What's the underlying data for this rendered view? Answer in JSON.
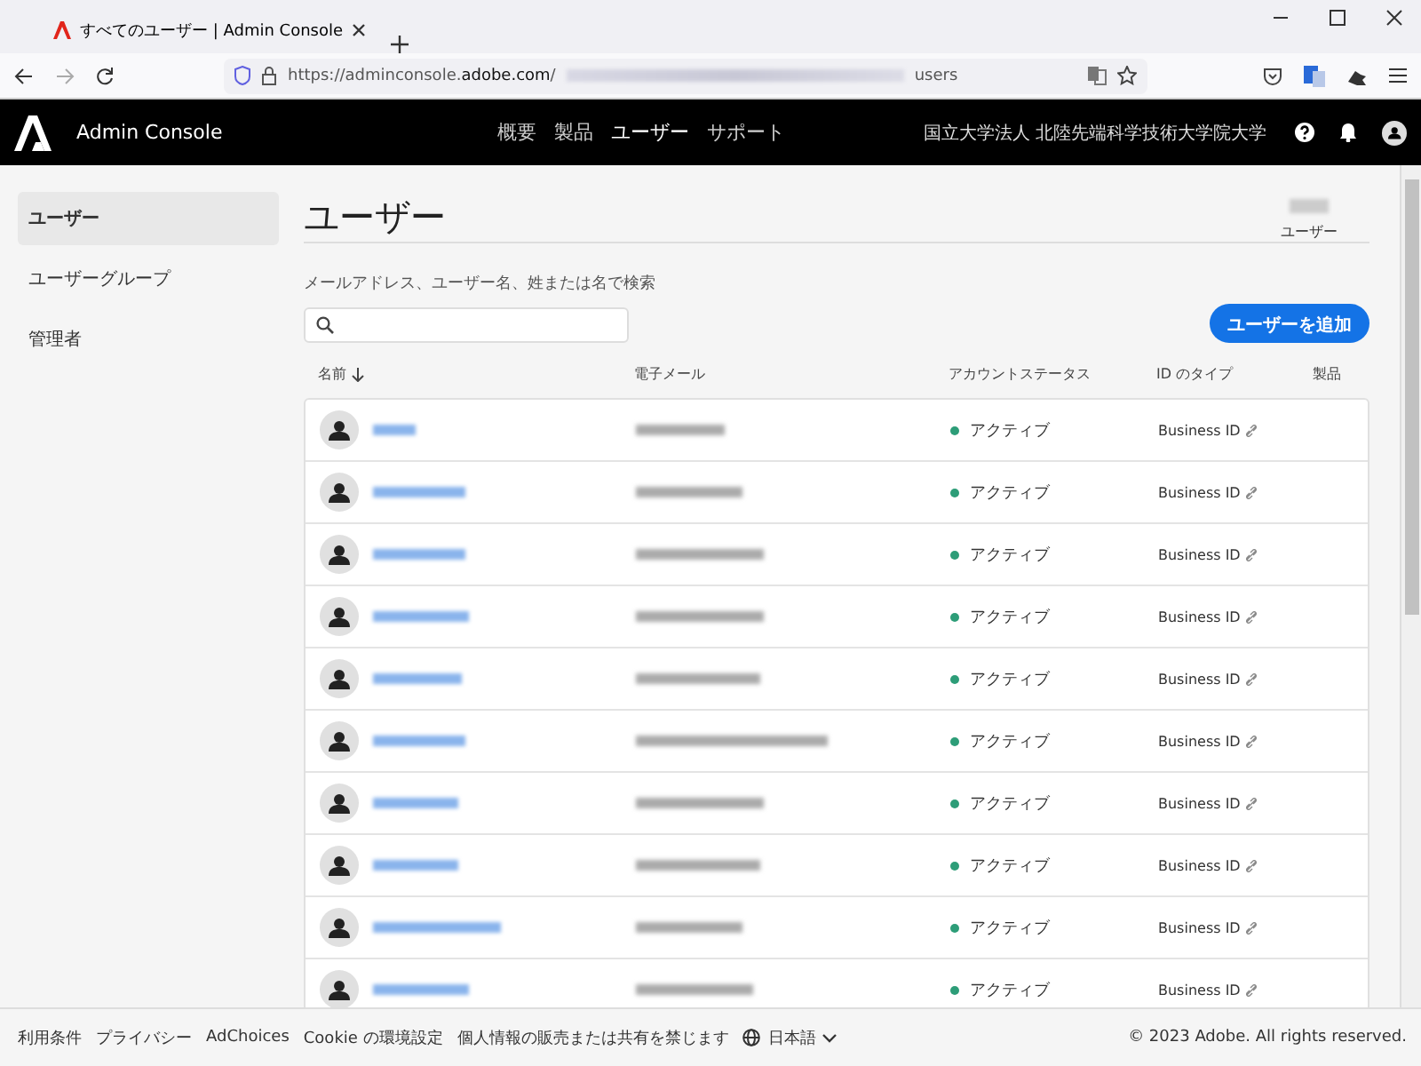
{
  "browser": {
    "tab_title": "すべてのユーザー | Admin Console",
    "url_start": "https://adminconsole.**adobe.com**/",
    "url_end": "users"
  },
  "header": {
    "app_name": "Admin Console",
    "nav": [
      {
        "label": "概要",
        "selected": false
      },
      {
        "label": "製品",
        "selected": false
      },
      {
        "label": "ユーザー",
        "selected": true
      },
      {
        "label": "サポート",
        "selected": false
      }
    ],
    "org": "国立大学法人 北陸先端科学技術大学院大学"
  },
  "sidebar": {
    "items": [
      {
        "label": "ユーザー",
        "selected": true
      },
      {
        "label": "ユーザーグループ",
        "selected": false
      },
      {
        "label": "管理者",
        "selected": false
      }
    ]
  },
  "page": {
    "title": "ユーザー",
    "count_label": "ユーザー",
    "search_label": "メールアドレス、ユーザー名、姓または名で検索",
    "add_button": "ユーザーを追加"
  },
  "table": {
    "columns": [
      {
        "label": "名前",
        "sorted": true
      },
      {
        "label": "電子メール",
        "sorted": false
      },
      {
        "label": "アカウントステータス",
        "sorted": false
      },
      {
        "label": "ID のタイプ",
        "sorted": false
      },
      {
        "label": "製品",
        "sorted": false
      }
    ],
    "rows": [
      {
        "status": "アクティブ",
        "id_type": "Business ID"
      },
      {
        "status": "アクティブ",
        "id_type": "Business ID"
      },
      {
        "status": "アクティブ",
        "id_type": "Business ID"
      },
      {
        "status": "アクティブ",
        "id_type": "Business ID"
      },
      {
        "status": "アクティブ",
        "id_type": "Business ID"
      },
      {
        "status": "アクティブ",
        "id_type": "Business ID"
      },
      {
        "status": "アクティブ",
        "id_type": "Business ID"
      },
      {
        "status": "アクティブ",
        "id_type": "Business ID"
      },
      {
        "status": "アクティブ",
        "id_type": "Business ID"
      },
      {
        "status": "アクティブ",
        "id_type": "Business ID"
      }
    ]
  },
  "footer": {
    "links": [
      "利用条件",
      "プライバシー",
      "AdChoices",
      "Cookie の環境設定",
      "個人情報の販売または共有を禁じます"
    ],
    "language": "日本語",
    "copyright": "© 2023 Adobe. All rights reserved."
  }
}
